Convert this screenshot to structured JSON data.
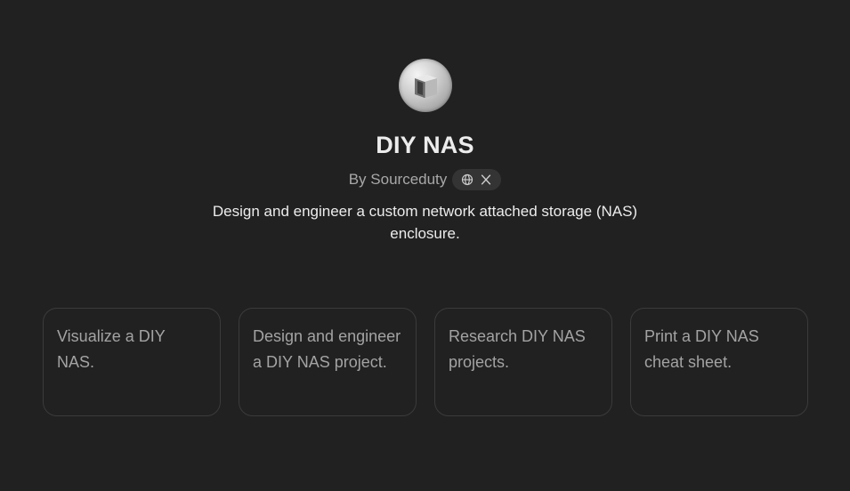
{
  "gpt": {
    "name": "DIY NAS",
    "byline": "By Sourceduty",
    "description": "Design and engineer a custom network attached storage (NAS) enclosure.",
    "links": [
      "globe-icon",
      "x-icon"
    ]
  },
  "suggestions": [
    "Visualize a DIY NAS.",
    "Design and engineer a DIY NAS project.",
    "Research DIY NAS projects.",
    "Print a DIY NAS cheat sheet."
  ],
  "colors": {
    "background": "#212121",
    "text": "#ececec",
    "muted": "#a3a3a3",
    "card_border": "#3b3b3b"
  }
}
